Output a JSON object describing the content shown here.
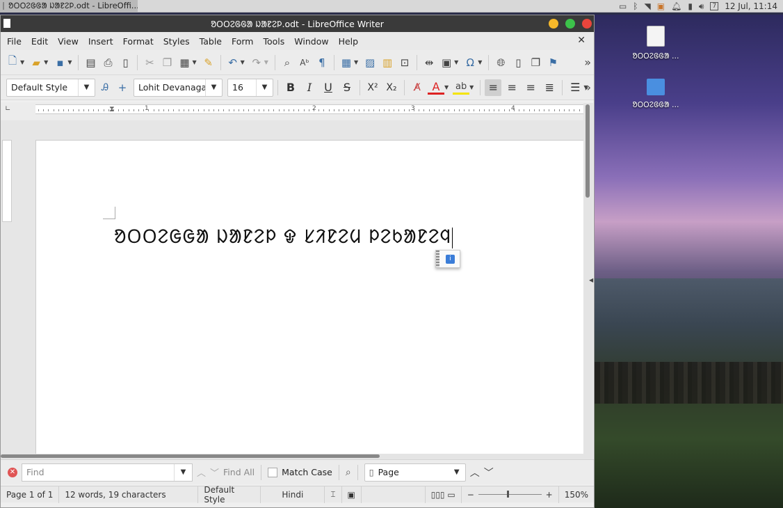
{
  "taskbar": {
    "window_button": "ᱚᱛᱛᱮᱜᱜᱟ ᱡᱟᱱᱮᱞ.odt - LibreOffi...",
    "date_time": "12 Jul, 11:14",
    "calendar_day": "7"
  },
  "window": {
    "title": "ᱚᱛᱛᱮᱜᱜᱟ ᱡᱟᱱᱮᱞ.odt - LibreOffice Writer"
  },
  "menu": [
    "File",
    "Edit",
    "View",
    "Insert",
    "Format",
    "Styles",
    "Table",
    "Form",
    "Tools",
    "Window",
    "Help"
  ],
  "formatting": {
    "paragraph_style": "Default Style",
    "font_name": "Lohit Devanaga",
    "font_size": "16"
  },
  "ruler": {
    "numbers": [
      "1",
      "2",
      "3",
      "4"
    ]
  },
  "document": {
    "text": "ᱚᱛᱛᱮᱜᱜᱟ ᱡᱟᱱᱮᱞ ᱫ ᱥᱤᱱᱮᱢ ᱞᱮᱠᱟᱱᱮᱧ"
  },
  "find": {
    "placeholder": "Find",
    "find_all": "Find All",
    "match_case": "Match Case",
    "search_scope": "Page"
  },
  "status": {
    "page": "Page 1 of 1",
    "words": "12 words, 19 characters",
    "style": "Default Style",
    "language": "Hindi",
    "zoom": "150%"
  },
  "desktop_icons": [
    {
      "label": "ᱚᱛᱛᱮᱜᱜᱟ ..."
    },
    {
      "label": "ᱚᱛᱛᱮᱜᱜᱟ ..."
    }
  ],
  "colors": {
    "titlebar": "#3a3a3a",
    "accent": "#3a6ea5",
    "close": "#e8453c",
    "minimize": "#f5b82a",
    "maximize": "#3cc24a"
  }
}
